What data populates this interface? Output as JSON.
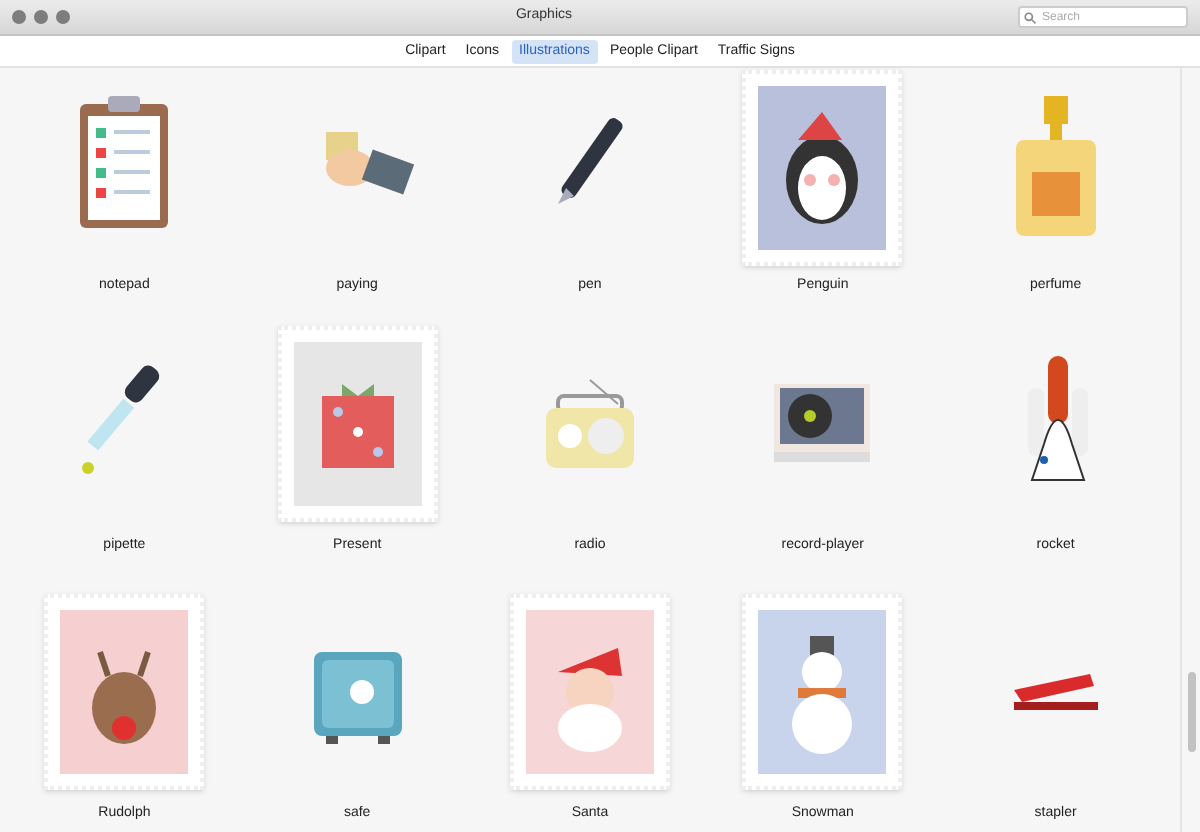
{
  "window": {
    "title": "Graphics"
  },
  "search": {
    "placeholder": "Search"
  },
  "tabs": [
    {
      "label": "Clipart",
      "selected": false
    },
    {
      "label": "Icons",
      "selected": false
    },
    {
      "label": "Illustrations",
      "selected": true
    },
    {
      "label": "People Clipart",
      "selected": false
    },
    {
      "label": "Traffic Signs",
      "selected": false
    }
  ],
  "gallery": [
    {
      "label": "notepad",
      "kind": "plain"
    },
    {
      "label": "paying",
      "kind": "plain"
    },
    {
      "label": "pen",
      "kind": "plain"
    },
    {
      "label": "Penguin",
      "kind": "stamp"
    },
    {
      "label": "perfume",
      "kind": "plain"
    },
    {
      "label": "pipette",
      "kind": "plain"
    },
    {
      "label": "Present",
      "kind": "stamp"
    },
    {
      "label": "radio",
      "kind": "plain"
    },
    {
      "label": "record-player",
      "kind": "plain"
    },
    {
      "label": "rocket",
      "kind": "plain"
    },
    {
      "label": "Rudolph",
      "kind": "stamp"
    },
    {
      "label": "safe",
      "kind": "plain"
    },
    {
      "label": "Santa",
      "kind": "stamp"
    },
    {
      "label": "Snowman",
      "kind": "stamp"
    },
    {
      "label": "stapler",
      "kind": "plain"
    }
  ]
}
